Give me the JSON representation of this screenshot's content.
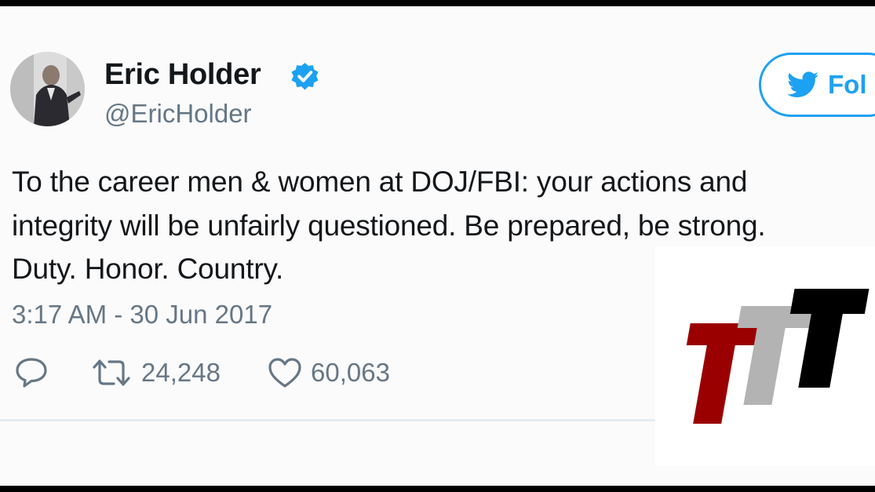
{
  "user": {
    "display_name": "Eric Holder",
    "handle": "@EricHolder",
    "verified": true,
    "avatar_icon": "profile-photo"
  },
  "follow_button": {
    "label": "Fol",
    "icon": "twitter-bird-icon",
    "color": "#1da1f2"
  },
  "tweet": {
    "lines": [
      "To the career men & women at DOJ/FBI: your actions and",
      "integrity will be unfairly questioned. Be prepared, be strong.",
      "Duty. Honor. Country."
    ],
    "timestamp": "3:17 AM - 30 Jun 2017"
  },
  "actions": {
    "reply": {
      "icon": "reply-icon"
    },
    "retweet": {
      "icon": "retweet-icon",
      "count": "24,248"
    },
    "like": {
      "icon": "heart-icon",
      "count": "60,063"
    }
  },
  "watermark": {
    "icon": "ttt-logo",
    "colors": [
      "#9b0000",
      "#b3b3b3",
      "#000000"
    ]
  }
}
